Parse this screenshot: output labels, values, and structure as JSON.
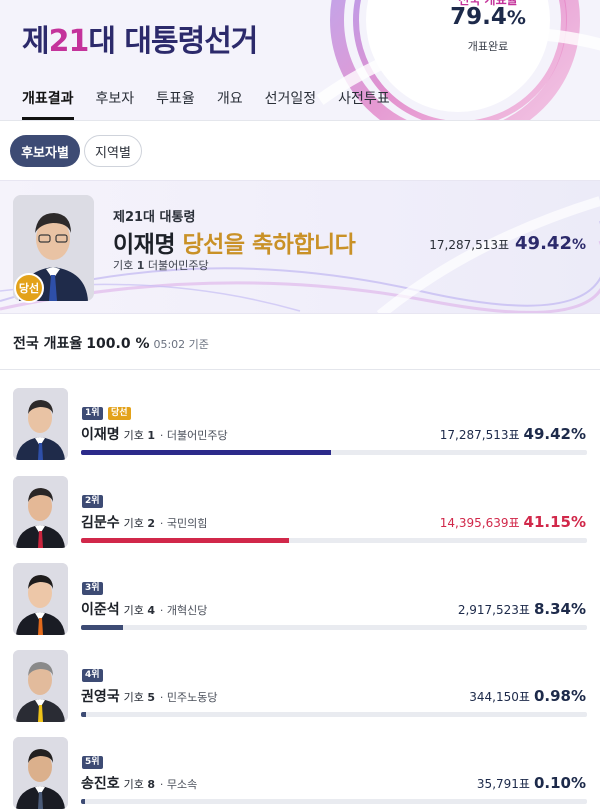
{
  "header": {
    "title_prefix": "제",
    "title_number": "21",
    "title_suffix": "대 대통령선거",
    "counting_label_cut": "전국 개표율",
    "counting_rate": "79.4",
    "counting_unit": "%",
    "counting_status": "개표완료"
  },
  "tabs": [
    {
      "label": "개표결과",
      "active": true
    },
    {
      "label": "후보자",
      "active": false
    },
    {
      "label": "투표율",
      "active": false
    },
    {
      "label": "개요",
      "active": false
    },
    {
      "label": "선거일정",
      "active": false
    },
    {
      "label": "사전투표",
      "active": false
    }
  ],
  "filters": {
    "candidate": "후보자별",
    "region": "지역별"
  },
  "winner": {
    "badge": "당선",
    "kicker": "제21대 대통령",
    "name": "이재명",
    "congrats": "당선을 축하합니다",
    "symbol_label": "기호",
    "symbol_number": "1",
    "party": "더불어민주당",
    "votes": "17,287,513표",
    "percent": "49.42",
    "percent_unit": "%"
  },
  "nationwide": {
    "label": "전국 개표율",
    "rate": "100.0 %",
    "time": "05:02 기준"
  },
  "candidates": [
    {
      "rank": "1위",
      "elected": "당선",
      "name": "이재명",
      "symbol": "기호",
      "number": "1",
      "party": "· 더불어민주당",
      "votes": "17,287,513표",
      "percent": "49.42%",
      "share": 0.4942,
      "color": "#2c2a8a",
      "text_color": "#1d2a4a",
      "suit": "#1f2b4a",
      "tie": "#2e4fa8"
    },
    {
      "rank": "2위",
      "elected": "",
      "name": "김문수",
      "symbol": "기호",
      "number": "2",
      "party": "· 국민의힘",
      "votes": "14,395,639표",
      "percent": "41.15%",
      "share": 0.4115,
      "color": "#d1284a",
      "text_color": "#d1284a",
      "suit": "#1a1c24",
      "tie": "#c8243d"
    },
    {
      "rank": "3위",
      "elected": "",
      "name": "이준석",
      "symbol": "기호",
      "number": "4",
      "party": "· 개혁신당",
      "votes": "2,917,523표",
      "percent": "8.34%",
      "share": 0.0834,
      "color": "#3d4b74",
      "text_color": "#1d2a4a",
      "suit": "#1a1c24",
      "tie": "#e36a1c"
    },
    {
      "rank": "4위",
      "elected": "",
      "name": "권영국",
      "symbol": "기호",
      "number": "5",
      "party": "· 민주노동당",
      "votes": "344,150표",
      "percent": "0.98%",
      "share": 0.0098,
      "color": "#3d4b74",
      "text_color": "#1d2a4a",
      "suit": "#2a2c34",
      "tie": "#f0c419"
    },
    {
      "rank": "5위",
      "elected": "",
      "name": "송진호",
      "symbol": "기호",
      "number": "8",
      "party": "· 무소속",
      "votes": "35,791표",
      "percent": "0.10%",
      "share": 0.001,
      "color": "#3d4b74",
      "text_color": "#1d2a4a",
      "suit": "#1a1c24",
      "tie": "#4a5a78"
    }
  ]
}
